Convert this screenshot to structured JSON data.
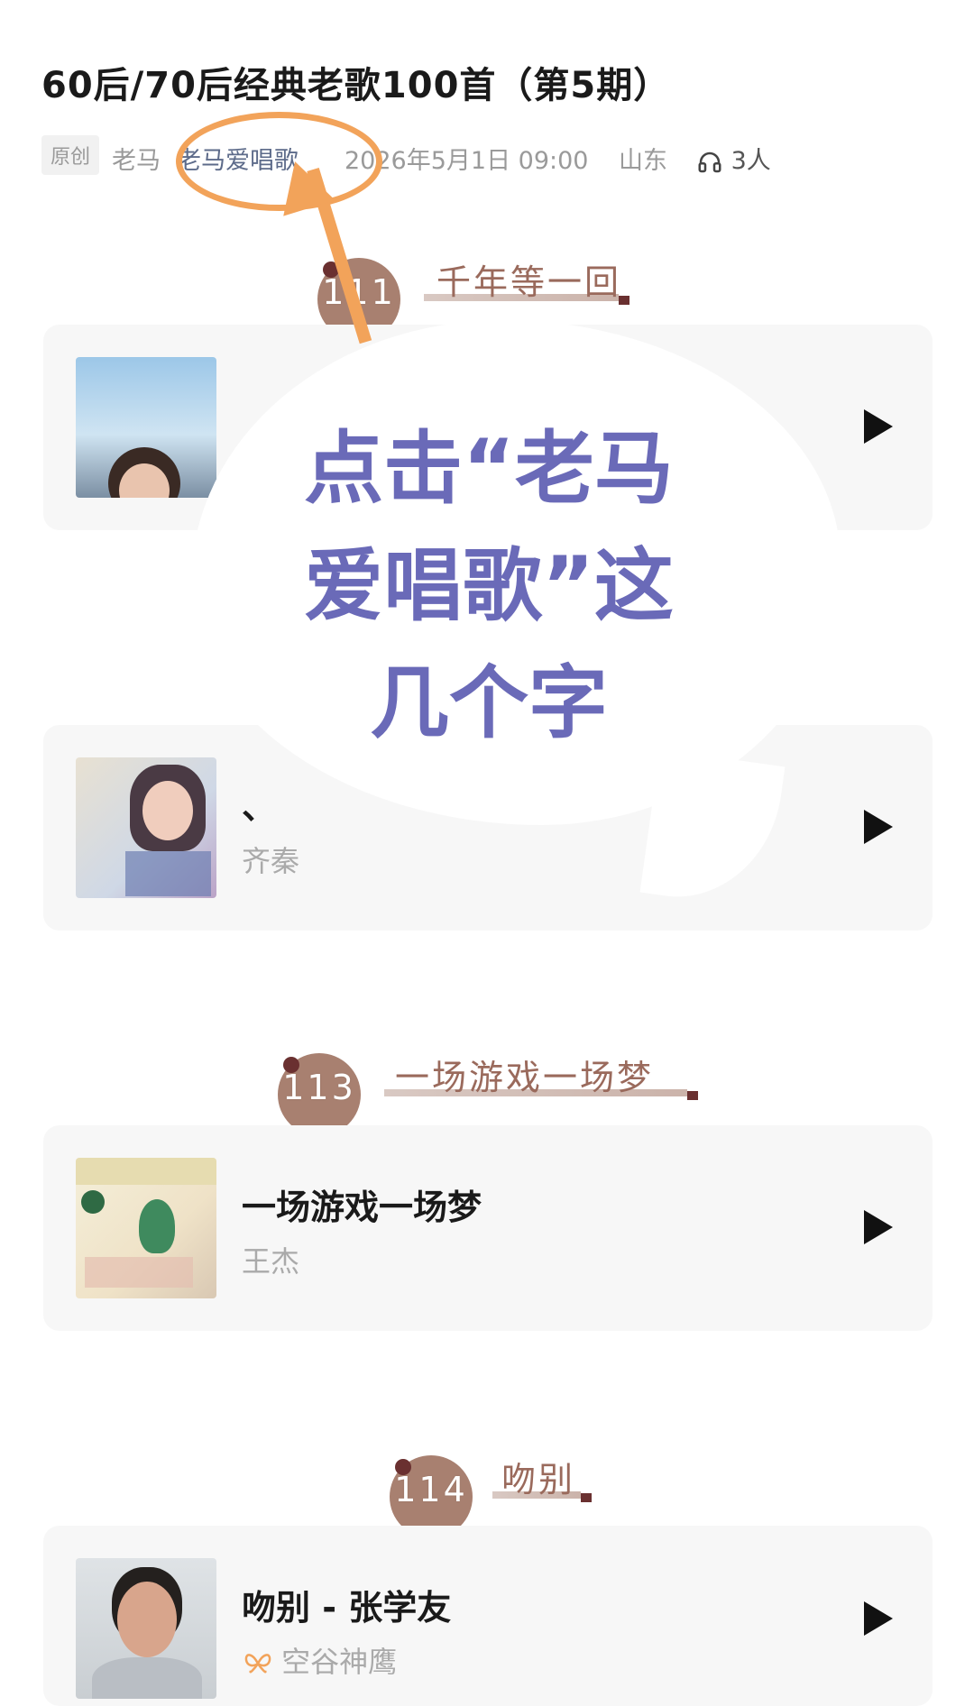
{
  "article": {
    "title": "60后/70后经典老歌100首（第5期）",
    "badge": "原创",
    "author": "老马",
    "account": "老马爱唱歌",
    "datetime": "2026年5月1日 09:00",
    "location": "山东",
    "listeners": "3人"
  },
  "annotation": {
    "line1": "点击“老马",
    "line2": "爱唱歌”这",
    "line3": "几个字"
  },
  "sections": [
    {
      "number": "111",
      "title": "千年等一回"
    },
    {
      "number": "113",
      "title": "一场游戏一场梦"
    },
    {
      "number": "114",
      "title": "吻别"
    }
  ],
  "songs": [
    {
      "title": "",
      "artist": ""
    },
    {
      "title": "、",
      "artist": "齐秦"
    },
    {
      "title": "一场游戏一场梦",
      "artist": "王杰"
    },
    {
      "title": "吻别 - 张学友",
      "artist": "空谷神鹰"
    }
  ],
  "colors": {
    "annotation_text": "#6a6ab8",
    "annotation_ring": "#f2a35a",
    "section_circle": "#a88070",
    "section_title": "#9a6a5c"
  }
}
